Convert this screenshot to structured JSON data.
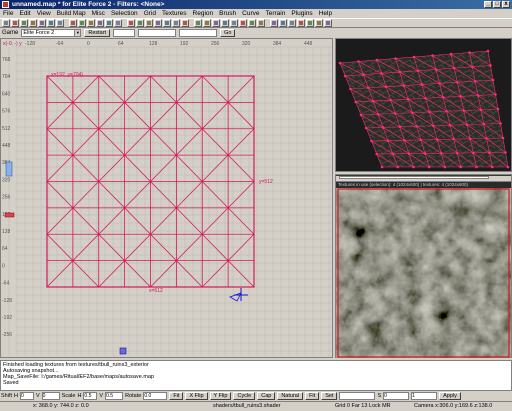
{
  "window": {
    "title": "unnamed.map * for Elite Force 2 - Filters: <None>"
  },
  "menu": [
    "File",
    "Edit",
    "View",
    "Build Map",
    "Misc",
    "Selection",
    "Grid",
    "Textures",
    "Region",
    "Brush",
    "Curve",
    "Terrain",
    "Plugins",
    "Help"
  ],
  "toolbar": {
    "icons": [
      "open-icon",
      "save-icon",
      "cut-icon",
      "copy-icon",
      "paste-icon",
      "undo-icon",
      "redo-icon",
      "x-axis-icon",
      "y-axis-icon",
      "z-axis-icon",
      "rotate-icon",
      "flip-icon",
      "select-icon",
      "clip-icon",
      "csg-subtract-icon",
      "csg-merge-icon",
      "hollow-icon",
      "texture-icon",
      "camera-icon",
      "patch-icon",
      "entity-icon",
      "brush-icon",
      "face-icon",
      "vertex-icon",
      "edge-icon",
      "light-icon",
      "filter-icon",
      "region-icon",
      "grid-icon",
      "snap-icon",
      "lock-icon",
      "scale-icon",
      "shader-icon",
      "fit-icon",
      "help-icon"
    ]
  },
  "gamebar": {
    "game_label": "Game",
    "game_value": "Elite Force 2",
    "restart_label": "Restart",
    "go_label": "Go"
  },
  "xy_view": {
    "corner_label": "x(-0, -) y",
    "top_ticks": [
      "-128",
      "-64",
      "0",
      "64",
      "128",
      "192",
      "256",
      "320",
      "384",
      "448",
      "5"
    ],
    "side_ticks": [
      "768",
      "704",
      "640",
      "576",
      "512",
      "448",
      "384",
      "320",
      "256",
      "192",
      "128",
      "64",
      "0",
      "-64",
      "-128",
      "-192",
      "-256"
    ],
    "label_top": "x=192, y=704)",
    "label_right": "y=512",
    "label_bottom": "x=512"
  },
  "texture_window": {
    "info": "Textures in use (selection): 4 (1024x600) | textures: 4 (1024x600)"
  },
  "console": {
    "lines": [
      "Finished loading textures from textures/tbull_ruins3_exterior",
      "Autosaving snapshot...",
      "Map_SaveFile: I:/games/Ritual/EF2/base/maps/autosave.map",
      "Saved"
    ]
  },
  "bottom_toolbar": {
    "shift_label": "Shift",
    "shift_h": "0",
    "shift_v": "0",
    "scale_label": "Scale",
    "scale_h": "0.5",
    "scale_v": "0.5",
    "rotate_label": "Rotate",
    "rotate_value": "0.0",
    "fit_label": "Fit",
    "xflip_label": "X Flip",
    "yflip_label": "Y Flip",
    "cycle_label": "Cycle",
    "cap_label": "Cap",
    "natural_label": "Natural",
    "fit2_label": "Fit",
    "set_label": "Set",
    "s_label": "S",
    "s_value": "0",
    "t_value": "1",
    "apply_label": "Apply"
  },
  "status": {
    "coords": "x: 368.0  y: 744.0  z: 0.0",
    "shader": "shaders/tbull_ruins3.shader",
    "grid": "Grid 0 Far 13 Lock MR",
    "camera": "Camera x:306.0 y:169.6 z:138.0"
  },
  "colors": {
    "patch": "#d4185a",
    "grid_bg": "#d4d0c8",
    "grid_line": "#b6b3ad",
    "titlebar": "#0a246a"
  }
}
